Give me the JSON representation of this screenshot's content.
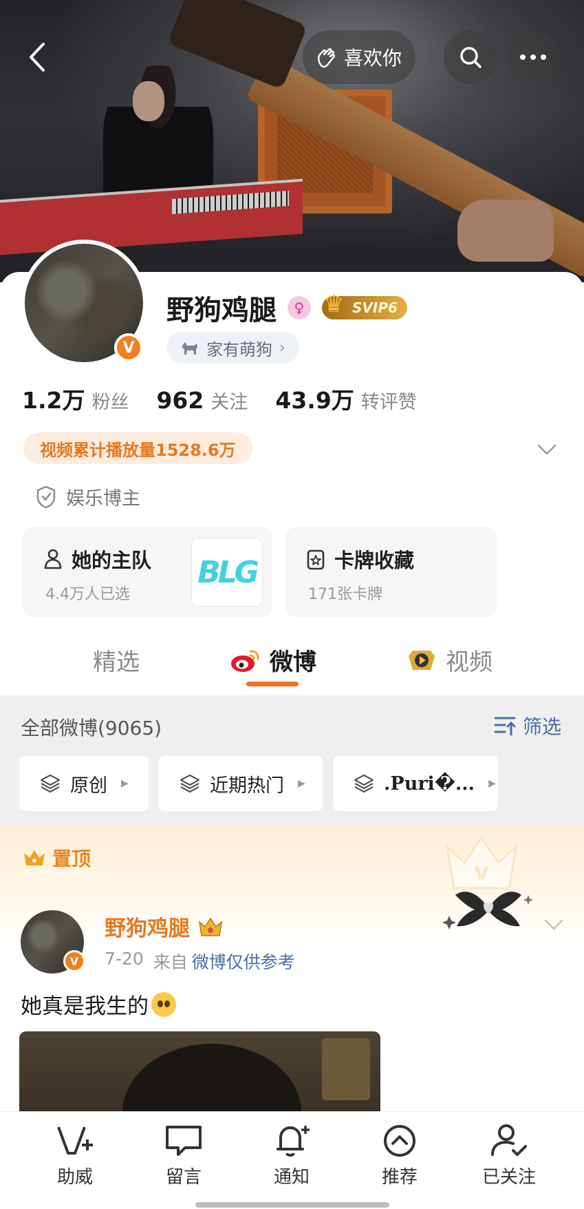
{
  "header": {
    "like_label": "喜欢你"
  },
  "profile": {
    "name": "野狗鸡腿",
    "vip_badge": "SVIP6",
    "tag": "家有萌狗",
    "verified_mark": "V",
    "stats": [
      {
        "value": "1.2万",
        "label": "粉丝"
      },
      {
        "value": "962",
        "label": "关注"
      },
      {
        "value": "43.9万",
        "label": "转评赞"
      }
    ],
    "play_count": "视频累计播放量1528.6万",
    "role": "娱乐博主",
    "team_card": {
      "title": "她的主队",
      "subtitle": "4.4万人已选",
      "logo_text": "BLG"
    },
    "cards_card": {
      "title": "卡牌收藏",
      "subtitle": "171张卡牌"
    }
  },
  "tabs": [
    {
      "label": "精选",
      "active": false
    },
    {
      "label": "微博",
      "active": true
    },
    {
      "label": "视频",
      "active": false
    }
  ],
  "feed": {
    "all_label": "全部微博(9065)",
    "filter_label": "筛选",
    "chips": [
      "原创",
      "近期热门",
      ".Puri�..."
    ]
  },
  "pinned": {
    "label": "置顶",
    "author": "野狗鸡腿",
    "date": "7-20",
    "from_label": "来自",
    "source": "微博仅供参考",
    "text": "她真是我生的"
  },
  "bottom_nav": [
    {
      "label": "助威",
      "icon": "cheer-icon"
    },
    {
      "label": "留言",
      "icon": "message-icon"
    },
    {
      "label": "通知",
      "icon": "bell-plus-icon"
    },
    {
      "label": "推荐",
      "icon": "recommend-icon"
    },
    {
      "label": "已关注",
      "icon": "user-check-icon"
    }
  ],
  "colors": {
    "accent": "#f2711c",
    "link": "#4a6ea9",
    "orange_badge": "#f37f1e"
  }
}
